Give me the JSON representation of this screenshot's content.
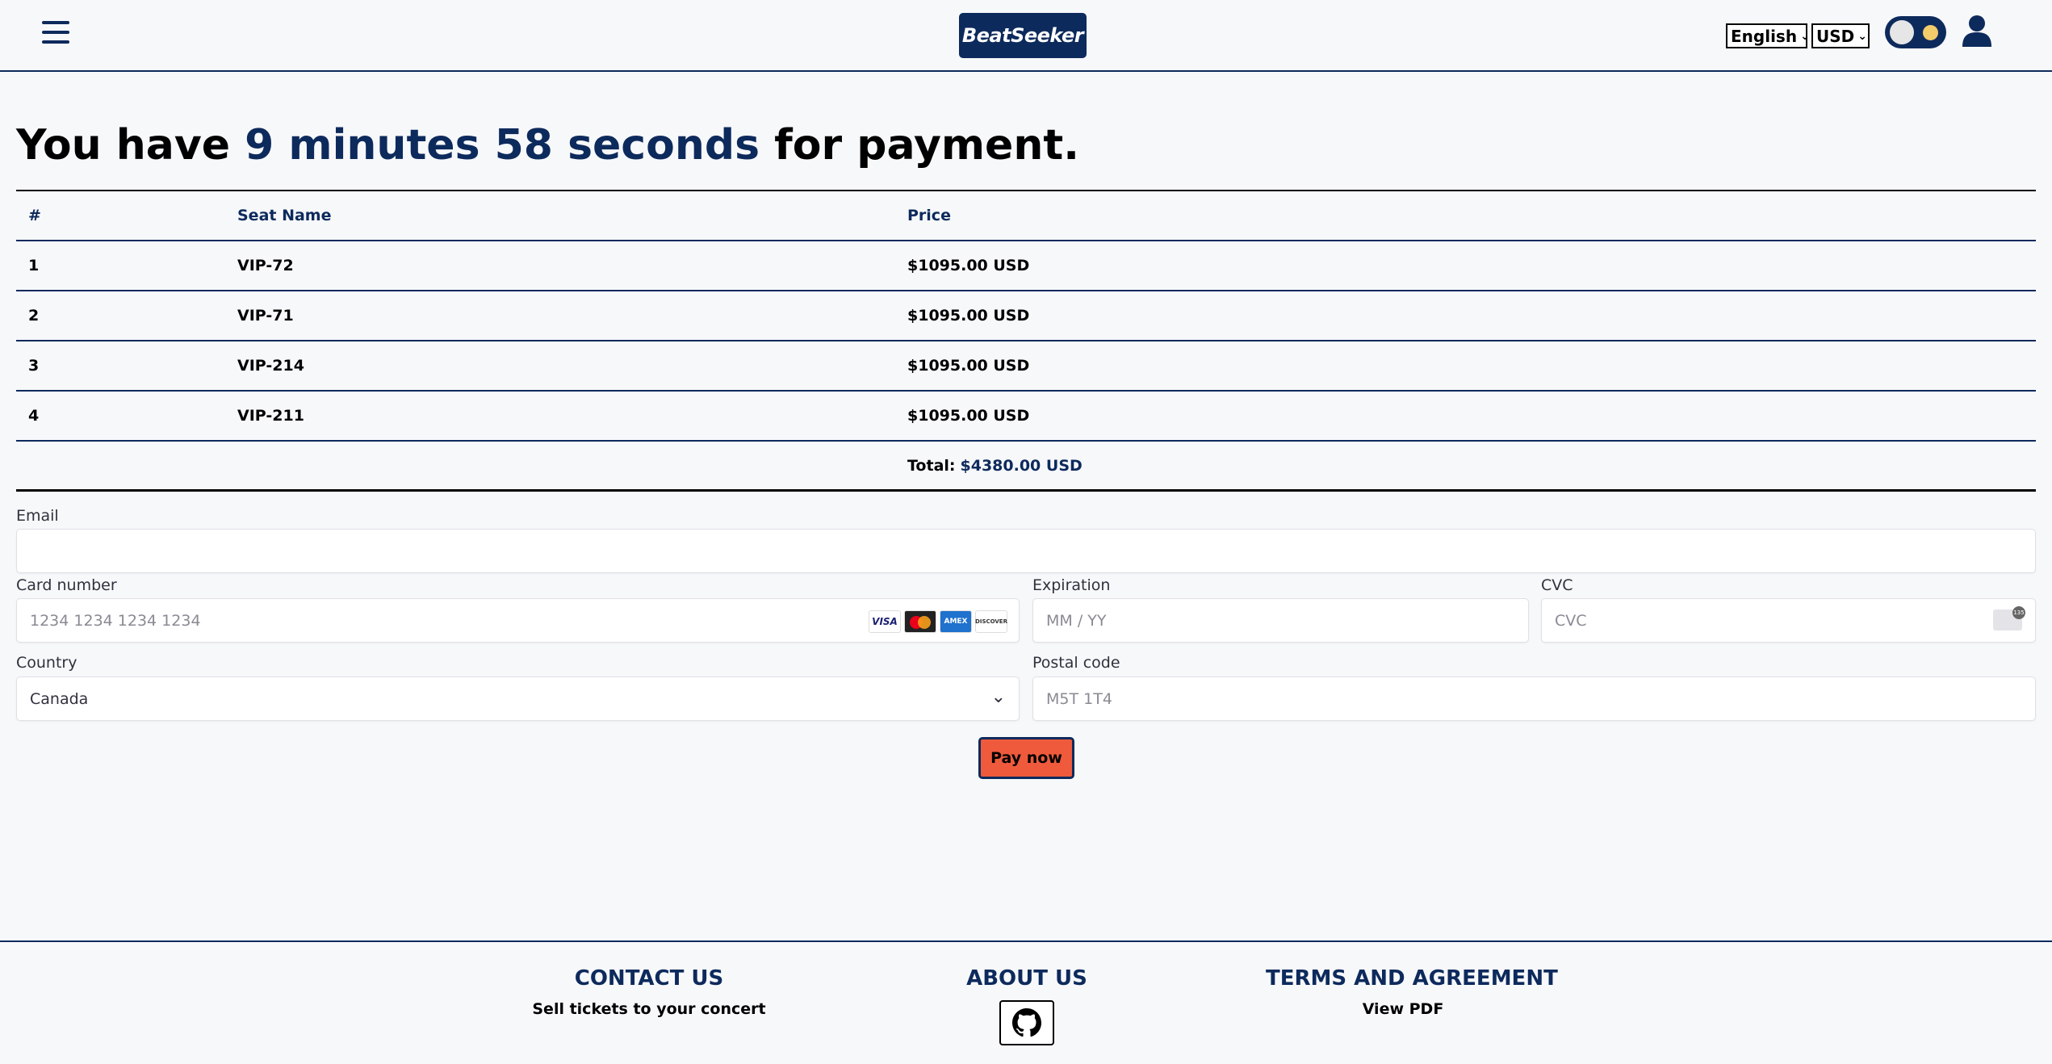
{
  "header": {
    "logo": "BeatSeeker",
    "language": "English",
    "currency": "USD"
  },
  "title": {
    "prefix": "You have ",
    "timer": "9 minutes 58 seconds",
    "suffix": " for payment."
  },
  "table": {
    "headers": [
      "#",
      "Seat Name",
      "Price"
    ],
    "rows": [
      {
        "num": "1",
        "seat": "VIP-72",
        "price": "$1095.00 USD"
      },
      {
        "num": "2",
        "seat": "VIP-71",
        "price": "$1095.00 USD"
      },
      {
        "num": "3",
        "seat": "VIP-214",
        "price": "$1095.00 USD"
      },
      {
        "num": "4",
        "seat": "VIP-211",
        "price": "$1095.00 USD"
      }
    ],
    "total_label": "Total:",
    "total_value": "$4380.00 USD"
  },
  "form": {
    "email_label": "Email",
    "email_value": "",
    "card_label": "Card number",
    "card_placeholder": "1234 1234 1234 1234",
    "card_brands": [
      "VISA",
      "Mastercard",
      "AMEX",
      "DISCOVER"
    ],
    "exp_label": "Expiration",
    "exp_placeholder": "MM / YY",
    "cvc_label": "CVC",
    "cvc_placeholder": "CVC",
    "country_label": "Country",
    "country_value": "Canada",
    "postal_label": "Postal code",
    "postal_placeholder": "M5T 1T4",
    "pay_label": "Pay now"
  },
  "footer": {
    "contact_heading": "CONTACT US",
    "contact_link": "Sell tickets to your concert",
    "about_heading": "ABOUT US",
    "about_icon": "github-icon",
    "terms_heading": "TERMS AND AGREEMENT",
    "terms_link": "View PDF"
  },
  "colors": {
    "primary": "#0d2a5c",
    "pay_button": "#ef5a3c",
    "background": "#f7f8fa"
  }
}
